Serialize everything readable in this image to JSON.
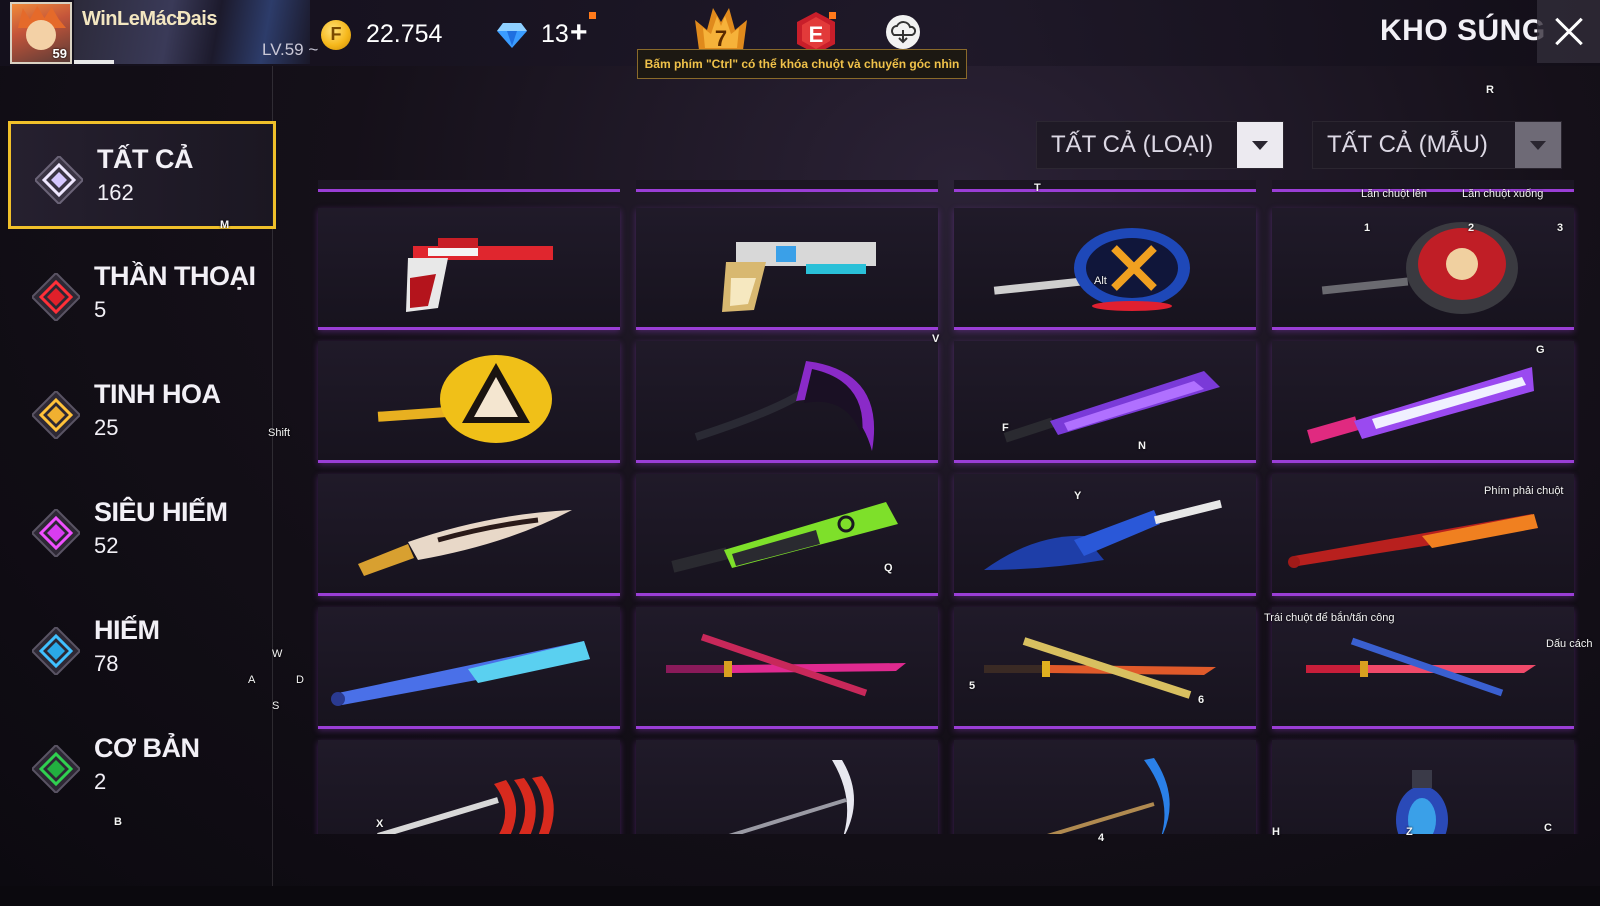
{
  "player": {
    "name": "WinLeMácĐais",
    "level_badge": "59",
    "level_label": "LV.59 ~"
  },
  "currency": {
    "coins": "22.754",
    "diamonds": "13",
    "plus": "+"
  },
  "badges": {
    "rank": "7",
    "elite": "E"
  },
  "tooltip": "Bấm phím \"Ctrl\" có thể khóa chuột và chuyển góc nhìn",
  "page_title": "KHO SÚNG",
  "filters": {
    "type": "TẤT CẢ (LOẠI)",
    "skin": "TẤT CẢ (MẪU)"
  },
  "categories": [
    {
      "name": "TẤT CẢ",
      "count": "162",
      "color": "#e4dcff"
    },
    {
      "name": "THẦN THOẠI",
      "count": "5",
      "color": "#e0202a"
    },
    {
      "name": "TINH HOA",
      "count": "25",
      "color": "#f0b030"
    },
    {
      "name": "SIÊU HIẾM",
      "count": "52",
      "color": "#d83cf0"
    },
    {
      "name": "HIẾM",
      "count": "78",
      "color": "#2aa8e8"
    },
    {
      "name": "CƠ BẢN",
      "count": "2",
      "color": "#22b040"
    }
  ],
  "items": [
    "revolver-red-skin",
    "revolver-gold-skin",
    "pan-blue-skin",
    "pan-red-skin",
    "pan-gold-skin",
    "scythe-purple-skin",
    "machete-purple-skin",
    "machete-chromo-skin",
    "dagger-gold-skin",
    "machete-green-skin",
    "sawfish-blade-skin",
    "bat-fire-skin",
    "bat-blue-skin",
    "katana-pink-skin",
    "katana-gold-skin",
    "katana-red-skin",
    "claw-red-skin",
    "scythe-silver-skin",
    "scythe-gold-skin",
    "grenade-blue-skin"
  ],
  "key_hints": {
    "r": "R",
    "t": "T",
    "m": "M",
    "wheel_up": "Lăn chuột lên",
    "wheel_down": "Lăn chuột xuống",
    "k1": "1",
    "k2": "2",
    "k3": "3",
    "alt": "Alt",
    "v": "V",
    "g": "G",
    "f": "F",
    "n": "N",
    "shift": "Shift",
    "y": "Y",
    "right_click": "Phím phải chuột",
    "q": "Q",
    "left_click": "Trái chuột để bắn/tấn công",
    "space": "Dấu cách",
    "w": "W",
    "a": "A",
    "d": "D",
    "s": "S",
    "k5": "5",
    "k6": "6",
    "x": "X",
    "k4": "4",
    "h": "H",
    "z": "Z",
    "c": "C",
    "b": "B"
  }
}
